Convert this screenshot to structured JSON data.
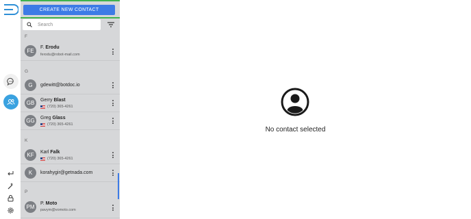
{
  "nav": {
    "logo": "logo-icon",
    "items": [
      "chat-icon",
      "contacts-icon"
    ],
    "bottom_items": [
      "logout-icon",
      "wand-icon",
      "lock-icon",
      "gear-icon"
    ]
  },
  "panel": {
    "create_label": "CREATE NEW CONTACT",
    "search_placeholder": "Search",
    "sections": [
      {
        "letter": "F"
      },
      {
        "letter": "G"
      },
      {
        "letter": "K"
      },
      {
        "letter": "P"
      }
    ],
    "contacts": [
      {
        "initials": "FE",
        "first": "F.",
        "last": "Erodu",
        "sub": "ferodu@robot-mail.com",
        "has_flag": false
      },
      {
        "initials": "G",
        "single": "gdewitt@botdoc.io"
      },
      {
        "initials": "GB",
        "first": "Gerry",
        "last": "Blast",
        "sub": "(720) 365-4261",
        "has_flag": true
      },
      {
        "initials": "GG",
        "first": "Greg",
        "last": "Glass",
        "sub": "(720) 365-4261",
        "has_flag": true
      },
      {
        "initials": "KF",
        "first": "Karl",
        "last": "Falk",
        "sub": "(720) 365-4261",
        "has_flag": true
      },
      {
        "initials": "K",
        "single": "korahygir@getnada.com"
      },
      {
        "initials": "PM",
        "first": "P.",
        "last": "Moto",
        "sub": "pavym@vomoto.com",
        "has_flag": false
      }
    ]
  },
  "main": {
    "empty_icon": "user-circle-icon",
    "empty_text": "No contact selected"
  },
  "colors": {
    "accent": "#3d7be6",
    "active_nav": "#3aa2e0",
    "highlight_border": "#3fb34f",
    "panel_bg": "#d6d7d9"
  }
}
